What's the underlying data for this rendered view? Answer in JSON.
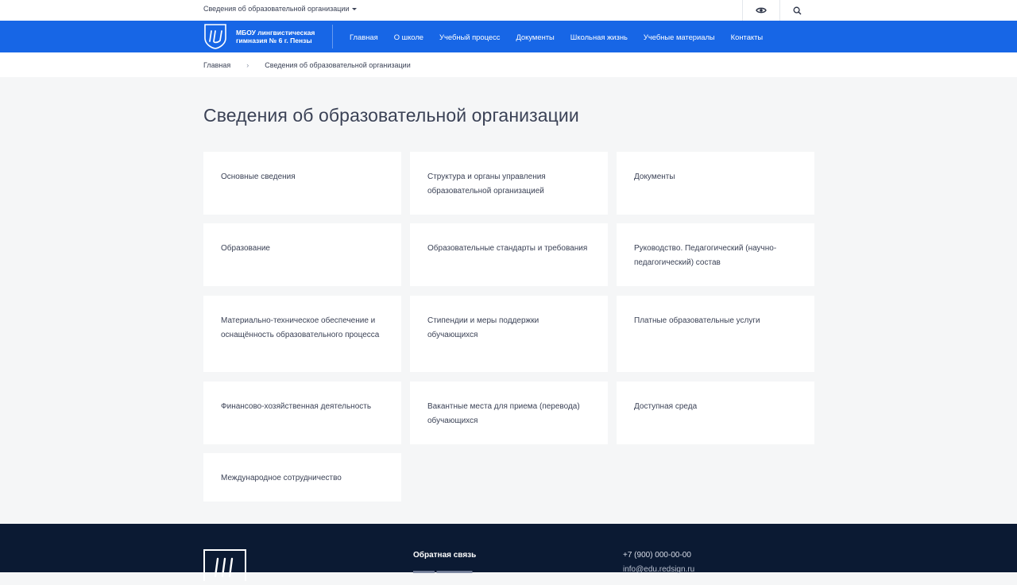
{
  "topbar": {
    "org_dropdown_label": "Сведения об образовательной организации"
  },
  "header": {
    "brand_line1": "МБОУ лингвистическая",
    "brand_line2": "гимназия № 6 г. Пензы",
    "menu": [
      {
        "label": "Главная"
      },
      {
        "label": "О школе"
      },
      {
        "label": "Учебный процесс"
      },
      {
        "label": "Документы"
      },
      {
        "label": "Школьная жизнь"
      },
      {
        "label": "Учебные материалы"
      },
      {
        "label": "Контакты"
      }
    ]
  },
  "breadcrumb": {
    "home": "Главная",
    "separator": "›",
    "current": "Сведения об образовательной организации"
  },
  "page": {
    "title": "Сведения об образовательной организации"
  },
  "cards": [
    {
      "label": "Основные сведения"
    },
    {
      "label": "Структура и органы управления образовательной организацией"
    },
    {
      "label": "Документы"
    },
    {
      "label": "Образование"
    },
    {
      "label": "Образовательные стандарты и требования"
    },
    {
      "label": "Руководство. Педагогический (научно-педагогический) состав"
    },
    {
      "label": "Материально-техническое обеспечение и оснащённость образовательного процесса"
    },
    {
      "label": "Стипендии и меры поддержки обучающихся"
    },
    {
      "label": "Платные образовательные услуги"
    },
    {
      "label": "Финансово-хозяйственная деятельность"
    },
    {
      "label": "Вакантные места для приема (перевода) обучающихся"
    },
    {
      "label": "Доступная среда"
    },
    {
      "label": "Международное сотрудничество"
    }
  ],
  "footer": {
    "feedback": "Обратная связь",
    "phone": "+7 (900) 000-00-00",
    "email": "info@edu.redsign.ru"
  },
  "colors": {
    "brand_blue": "#1766e6",
    "footer_bg": "#0b1a33",
    "page_bg": "#f5f6f7"
  },
  "icons": [
    "visually-impaired-eye-icon",
    "search-icon",
    "logo-icon"
  ]
}
